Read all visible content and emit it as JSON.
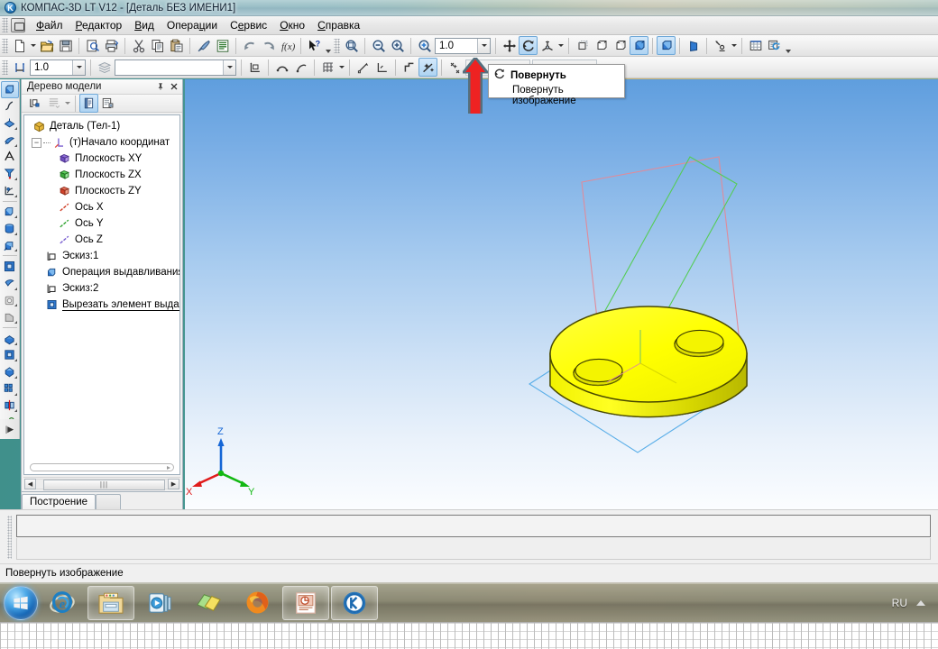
{
  "window": {
    "title": "КОМПАС-3D LT V12 - [Деталь БЕЗ ИМЕНИ1]",
    "app_icon": "kompas-logo-icon"
  },
  "menu": {
    "items": [
      {
        "label": "Файл",
        "mnemonic": "Ф"
      },
      {
        "label": "Редактор",
        "mnemonic": "Р"
      },
      {
        "label": "Вид",
        "mnemonic": "В"
      },
      {
        "label": "Операции",
        "mnemonic": "ц"
      },
      {
        "label": "Сервис",
        "mnemonic": "е"
      },
      {
        "label": "Окно",
        "mnemonic": "О"
      },
      {
        "label": "Справка",
        "mnemonic": "С"
      }
    ]
  },
  "toolbar_standard": {
    "buttons": [
      {
        "name": "new-document-button",
        "icon": "new-document-icon"
      },
      {
        "name": "new-document-dropdown",
        "icon": "chevron-down-icon"
      },
      {
        "name": "open-document-button",
        "icon": "open-folder-icon"
      },
      {
        "name": "save-document-button",
        "icon": "floppy-disk-icon"
      },
      {
        "name": "print-preview-button",
        "icon": "print-preview-icon"
      },
      {
        "name": "print-button",
        "icon": "printer-icon"
      },
      {
        "name": "cut-button",
        "icon": "scissors-icon"
      },
      {
        "name": "copy-button",
        "icon": "copy-icon"
      },
      {
        "name": "paste-button",
        "icon": "paste-icon"
      },
      {
        "name": "format-painter-button",
        "icon": "brush-icon"
      },
      {
        "name": "properties-button",
        "icon": "list-icon"
      },
      {
        "name": "undo-button",
        "icon": "undo-arrow-icon"
      },
      {
        "name": "redo-button",
        "icon": "redo-arrow-icon"
      },
      {
        "name": "variables-button",
        "icon": "fx-icon"
      },
      {
        "name": "context-help-button",
        "icon": "help-pointer-icon"
      }
    ]
  },
  "toolbar_view": {
    "zoom_value": "1.0",
    "buttons": [
      {
        "name": "zoom-window-button",
        "icon": "zoom-window-icon"
      },
      {
        "name": "zoom-out-button",
        "icon": "zoom-out-icon"
      },
      {
        "name": "zoom-in-button",
        "icon": "zoom-in-icon"
      },
      {
        "name": "zoom-scale-button",
        "icon": "zoom-scale-icon"
      },
      {
        "name": "pan-button",
        "icon": "pan-move-icon"
      },
      {
        "name": "rotate-button",
        "icon": "rotate-icon",
        "state": "active"
      },
      {
        "name": "orientation-button",
        "icon": "orientation-axis-icon"
      },
      {
        "name": "orientation-dropdown",
        "icon": "chevron-down-icon"
      },
      {
        "name": "wireframe-button",
        "icon": "wireframe-cube-icon"
      },
      {
        "name": "hidden-lines-thin-button",
        "icon": "hidden-lines-cube-icon"
      },
      {
        "name": "no-hidden-lines-button",
        "icon": "no-hidden-lines-cube-icon"
      },
      {
        "name": "shaded-with-edges-button",
        "icon": "shaded-edges-cube-icon",
        "state": "active"
      },
      {
        "name": "shaded-button",
        "icon": "shaded-cube-icon",
        "state": "active"
      },
      {
        "name": "perspective-button",
        "icon": "perspective-icon"
      },
      {
        "name": "section-button",
        "icon": "section-plane-icon"
      },
      {
        "name": "section-dropdown",
        "icon": "chevron-down-icon"
      },
      {
        "name": "sketch-mode-button",
        "icon": "sketch-grid-icon"
      },
      {
        "name": "rebuild-button",
        "icon": "rebuild-refresh-icon"
      }
    ]
  },
  "toolbar_current_state": {
    "step_value": "1.0",
    "layer_value": "",
    "field_1": "",
    "field_2": "",
    "buttons": [
      {
        "name": "snap-step-button",
        "icon": "step-snap-icon"
      },
      {
        "name": "layers-button",
        "icon": "layers-icon"
      },
      {
        "name": "local-cs-button",
        "icon": "local-coordinate-icon"
      },
      {
        "name": "parametrize-button",
        "icon": "parametrize-icon"
      },
      {
        "name": "constraints-button",
        "icon": "constraints-icon"
      },
      {
        "name": "grid-button",
        "icon": "grid-icon"
      },
      {
        "name": "grid-dropdown",
        "icon": "chevron-down-icon"
      },
      {
        "name": "snap-to-object-button",
        "icon": "snap-object-icon"
      },
      {
        "name": "snap-angle-button",
        "icon": "snap-angle-icon"
      },
      {
        "name": "ortho-button",
        "icon": "ortho-icon"
      },
      {
        "name": "global-snaps-button",
        "icon": "global-snaps-icon",
        "state": "active"
      },
      {
        "name": "forbid-snaps-button",
        "icon": "forbid-snaps-icon"
      }
    ]
  },
  "left_toolbar": {
    "buttons": [
      {
        "name": "geometry-button",
        "icon": "solid-cube-icon",
        "state": "active"
      },
      {
        "name": "spline-button",
        "icon": "spline-curve-icon"
      },
      {
        "name": "surface-button",
        "icon": "surface-icon"
      },
      {
        "name": "shell-button",
        "icon": "shell-icon"
      },
      {
        "name": "dimension-button",
        "icon": "dimension-arrow-icon"
      },
      {
        "name": "annotation-button",
        "icon": "annotation-icon"
      },
      {
        "name": "measure-button",
        "icon": "measure-icon"
      },
      {
        "name": "extrude-boss-button",
        "icon": "extrude-boss-icon"
      },
      {
        "name": "revolve-boss-button",
        "icon": "revolve-boss-icon"
      },
      {
        "name": "sweep-boss-button",
        "icon": "sweep-boss-icon"
      },
      {
        "name": "loft-boss-button",
        "icon": "loft-boss-icon"
      },
      {
        "name": "extrude-cut-button",
        "icon": "extrude-cut-icon"
      },
      {
        "name": "revolve-cut-button",
        "icon": "revolve-cut-icon"
      },
      {
        "name": "round-button",
        "icon": "fillet-icon"
      },
      {
        "name": "chamfer-button",
        "icon": "chamfer-icon"
      },
      {
        "name": "hole-button",
        "icon": "hole-icon"
      },
      {
        "name": "rib-button",
        "icon": "rib-icon"
      },
      {
        "name": "shell-cut-button",
        "icon": "shell-cut-icon"
      },
      {
        "name": "array-button",
        "icon": "array-icon"
      },
      {
        "name": "mirror-button",
        "icon": "mirror-icon"
      },
      {
        "name": "auxiliary-button",
        "icon": "auxiliary-geometry-icon"
      }
    ],
    "expand_label": "|▶"
  },
  "tree_panel": {
    "title": "Дерево модели",
    "pin_icon": "pin-icon",
    "close_icon": "close-icon",
    "toolbar": [
      {
        "name": "tree-show-structure-button",
        "icon": "tree-structure-icon"
      },
      {
        "name": "tree-filter-button",
        "icon": "tree-filter-icon"
      },
      {
        "name": "tree-filter-dropdown",
        "icon": "chevron-down-icon"
      },
      {
        "name": "tree-view-model-button",
        "icon": "tree-model-view-icon",
        "state": "active"
      },
      {
        "name": "tree-view-structure-button",
        "icon": "tree-structure-view-icon"
      }
    ],
    "items": [
      {
        "label": "Деталь (Тел-1)",
        "icon": "part-body-icon",
        "indent": 0,
        "color": "#c8a13a"
      },
      {
        "label": "(т)Начало координат",
        "icon": "origin-icon",
        "indent": 1,
        "expander": "minus"
      },
      {
        "label": "Плоскость XY",
        "icon": "plane-xy-icon",
        "indent": 2,
        "color": "#7a5fd0"
      },
      {
        "label": "Плоскость ZX",
        "icon": "plane-zx-icon",
        "indent": 2,
        "color": "#35a635"
      },
      {
        "label": "Плоскость ZY",
        "icon": "plane-zy-icon",
        "indent": 2,
        "color": "#d0422a"
      },
      {
        "label": "Ось X",
        "icon": "axis-x-icon",
        "indent": 2,
        "color": "#d0422a"
      },
      {
        "label": "Ось Y",
        "icon": "axis-y-icon",
        "indent": 2,
        "color": "#35a635"
      },
      {
        "label": "Ось Z",
        "icon": "axis-z-icon",
        "indent": 2,
        "color": "#7a5fd0"
      },
      {
        "label": "Эскиз:1",
        "icon": "sketch-icon",
        "indent": 1
      },
      {
        "label": "Операция выдавливания",
        "icon": "extrude-operation-icon",
        "indent": 1
      },
      {
        "label": "Эскиз:2",
        "icon": "sketch-icon",
        "indent": 1
      },
      {
        "label": "Вырезать элемент выдав.",
        "icon": "cut-extrude-icon",
        "indent": 1,
        "selected": true
      }
    ]
  },
  "tab_strip": {
    "tabs": [
      {
        "label": "Построение",
        "active": true
      },
      {
        "label": "",
        "active": false
      }
    ]
  },
  "tooltip": {
    "icon": "rotate-icon",
    "title": "Повернуть",
    "description": "Повернуть изображение"
  },
  "annotation": {
    "arrow": "red-up-arrow",
    "color": "#e21b1b"
  },
  "viewport": {
    "background_top": "#5f9ede",
    "background_bottom": "#fbfdff",
    "model": {
      "name": "yellow-cylinder-with-two-holes",
      "body_color": "#ffff00",
      "shade_color": "#c8c800",
      "edge_color": "#4a4a00"
    },
    "planes": [
      {
        "name": "plane-zy",
        "color": "#e08b9a"
      },
      {
        "name": "plane-zx",
        "color": "#55cc55"
      },
      {
        "name": "plane-xy",
        "color": "#5aaee8"
      }
    ],
    "axis_triad": {
      "x_label": "X",
      "x_color": "#e01b1b",
      "y_label": "Y",
      "y_color": "#12b812",
      "z_label": "Z",
      "z_color": "#1566d6"
    }
  },
  "status_bar": {
    "message": "Повернуть изображение"
  },
  "taskbar": {
    "start_label": "start-orb",
    "tasks": [
      {
        "name": "taskbar-internet-explorer",
        "icon": "internet-explorer-icon",
        "open": false
      },
      {
        "name": "taskbar-windows-explorer",
        "icon": "folder-explorer-icon",
        "open": true
      },
      {
        "name": "taskbar-media-player",
        "icon": "media-player-icon",
        "open": false
      },
      {
        "name": "taskbar-sticky-notes",
        "icon": "sticky-notes-icon",
        "open": false
      },
      {
        "name": "taskbar-firefox",
        "icon": "firefox-icon",
        "open": false
      },
      {
        "name": "taskbar-powerpoint",
        "icon": "powerpoint-icon",
        "open": true
      },
      {
        "name": "taskbar-kompas-3d",
        "icon": "kompas-icon",
        "open": true
      }
    ],
    "tray": {
      "language": "RU",
      "show_hidden_icon": "triangle-up-icon"
    }
  }
}
